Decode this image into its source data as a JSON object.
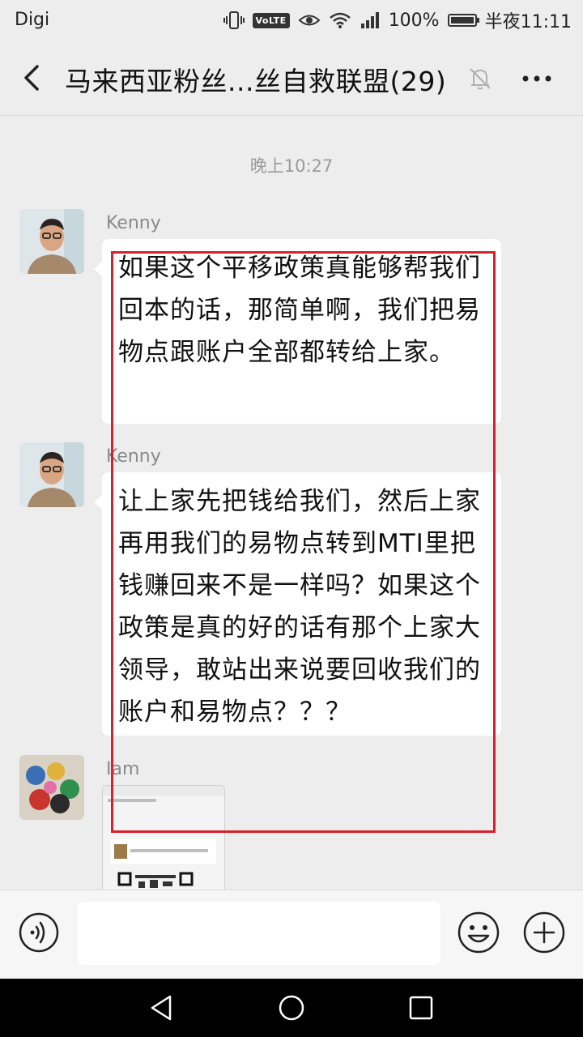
{
  "status_bar": {
    "carrier": "Digi",
    "volte": "VoLTE",
    "battery_percent": "100%",
    "time": "半夜11:11"
  },
  "header": {
    "title": "马来西亚粉丝...丝自救联盟(29)",
    "back_icon": "chevron-left-icon",
    "mute_icon": "bell-off-icon",
    "more_icon": "more-dots-icon"
  },
  "chat": {
    "timestamp": "晚上10:27",
    "messages": [
      {
        "sender": "Kenny",
        "text": "如果这个平移政策真能够帮我们回本的话，那简单啊，我们把易物点跟账户全部都转给上家。"
      },
      {
        "sender": "Kenny",
        "text": "让上家先把钱给我们，然后上家再用我们的易物点转到MTI里把钱赚回来不是一样吗？如果这个政策是真的好的话有那个上家大领导，敢站出来说要回收我们的账户和易物点？？？"
      },
      {
        "sender": "Iam",
        "type": "image"
      }
    ]
  },
  "input_bar": {
    "placeholder": "",
    "voice_icon": "voice-icon",
    "emoji_icon": "emoji-icon",
    "add_icon": "plus-icon"
  },
  "colors": {
    "background": "#ededed",
    "bubble": "#ffffff",
    "highlight": "#d8202a"
  }
}
